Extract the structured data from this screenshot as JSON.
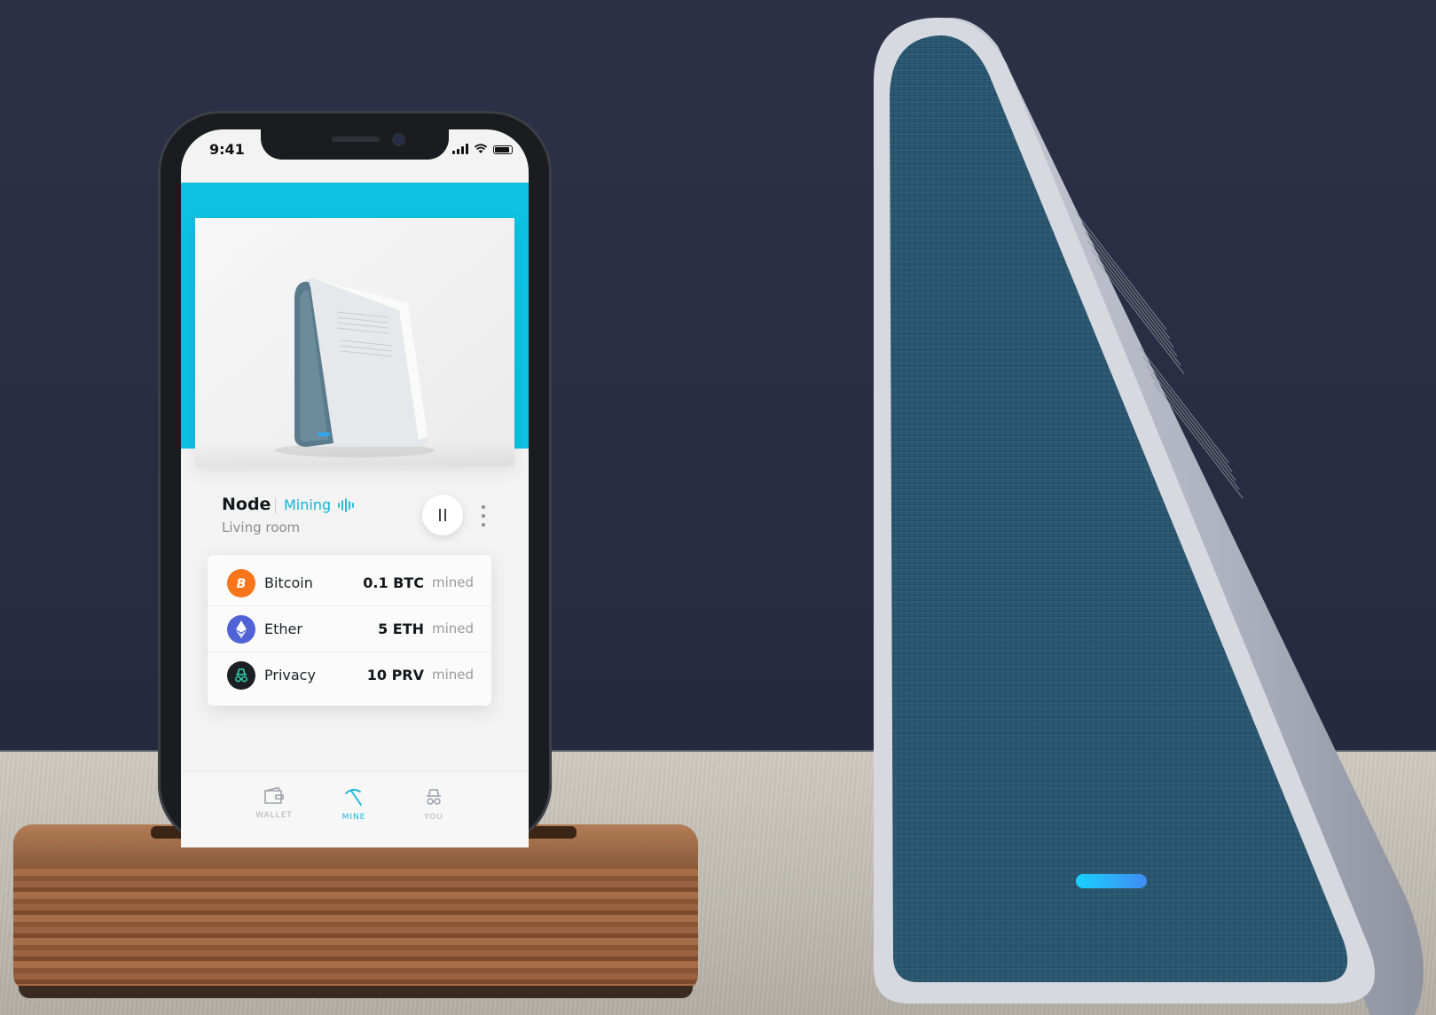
{
  "status_bar": {
    "time": "9:41"
  },
  "node": {
    "name": "Node",
    "status": "Mining",
    "location": "Living room"
  },
  "coins": [
    {
      "name": "Bitcoin",
      "amount": "0.1 BTC",
      "suffix": "mined",
      "icon": "bitcoin-icon",
      "color": "#f7761b"
    },
    {
      "name": "Ether",
      "amount": "5 ETH",
      "suffix": "mined",
      "icon": "ether-icon",
      "color": "#4f63d6"
    },
    {
      "name": "Privacy",
      "amount": "10 PRV",
      "suffix": "mined",
      "icon": "privacy-icon",
      "color": "#1c1f24"
    }
  ],
  "tabs": [
    {
      "label": "WALLET",
      "icon": "wallet-icon",
      "active": false
    },
    {
      "label": "MINE",
      "icon": "pickaxe-icon",
      "active": true
    },
    {
      "label": "YOU",
      "icon": "incognito-icon",
      "active": false
    }
  ],
  "colors": {
    "accent": "#0ec1e2",
    "fabric": "#2b5a72",
    "led": "#2ea8f2"
  }
}
